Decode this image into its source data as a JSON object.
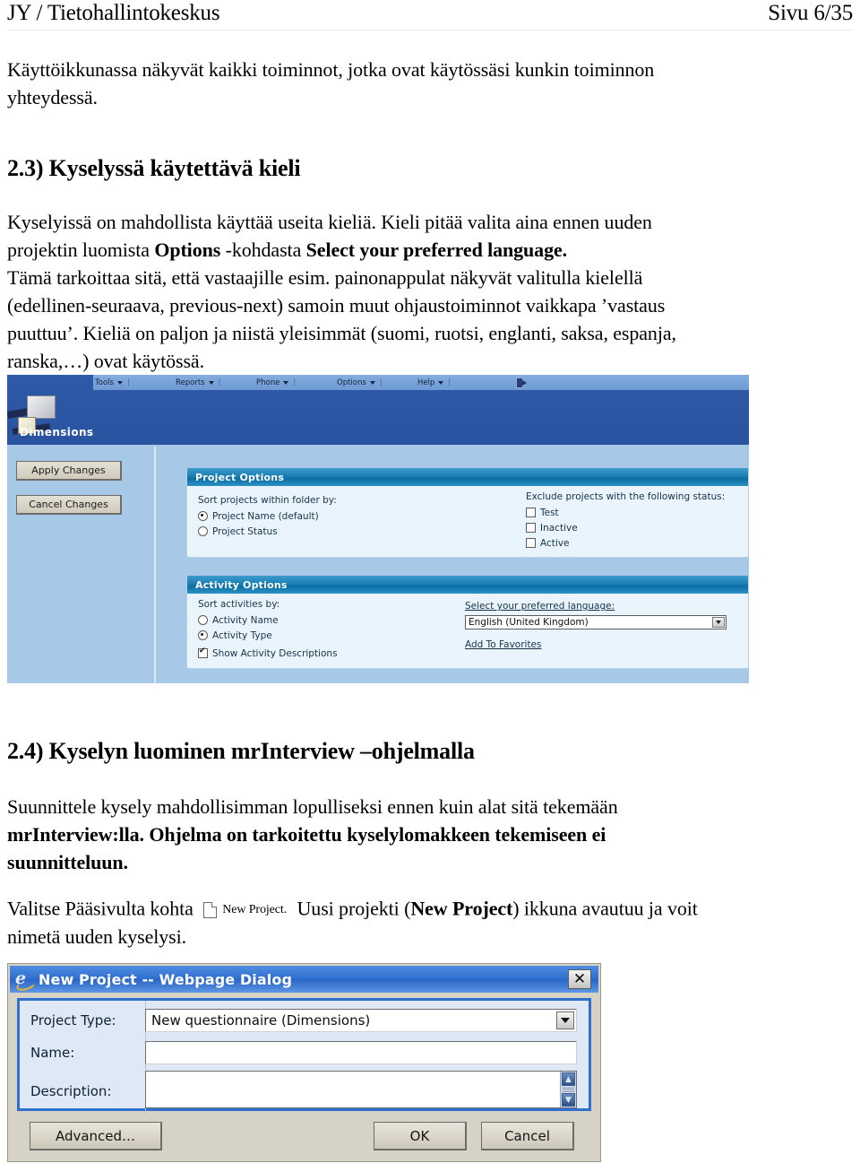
{
  "header": {
    "left": "JY / Tietohallintokeskus",
    "right": "Sivu 6/35"
  },
  "intro": {
    "line1": "Käyttöikkunassa näkyvät kaikki toiminnot, jotka ovat käytössäsi kunkin toiminnon",
    "line2": "yhteydessä."
  },
  "section23": {
    "heading": "2.3) Kyselyssä käytettävä kieli",
    "p1_a": "Kyselyissä on mahdollista käyttää useita kieliä. Kieli pitää valita aina ennen uuden",
    "p1_b": "projektin luomista ",
    "p1_bold1": "Options",
    "p1_c": " -kohdasta ",
    "p1_bold2": "Select your preferred language.",
    "p2": "Tämä tarkoittaa sitä, että vastaajille esim. painonappulat näkyvät valitulla kielellä",
    "p3": "(edellinen-seuraava, previous-next) samoin muut ohjaustoiminnot vaikkapa ’vastaus",
    "p4": "puuttuu’. Kieliä on paljon ja niistä yleisimmät (suomi, ruotsi, englanti, saksa, espanja,",
    "p5": "ranska,…) ovat käytössä."
  },
  "dimensions_app": {
    "wordmark": "Dimensions",
    "menu": [
      {
        "label": "Tools"
      },
      {
        "label": "Reports"
      },
      {
        "label": "Phone"
      },
      {
        "label": "Options"
      },
      {
        "label": "Help"
      }
    ],
    "logout_icon": "logout-icon",
    "buttons": {
      "apply": "Apply Changes",
      "cancel": "Cancel Changes"
    },
    "project_options": {
      "title": "Project Options",
      "sort_label": "Sort projects within folder by:",
      "sort_options": [
        {
          "label": "Project Name (default)",
          "selected": true
        },
        {
          "label": "Project Status",
          "selected": false
        }
      ],
      "exclude_label": "Exclude projects with the following status:",
      "exclude_options": [
        {
          "label": "Test",
          "checked": false
        },
        {
          "label": "Inactive",
          "checked": false
        },
        {
          "label": "Active",
          "checked": false
        }
      ]
    },
    "activity_options": {
      "title": "Activity Options",
      "sort_label": "Sort activities by:",
      "sort_options": [
        {
          "label": "Activity Name",
          "selected": false
        },
        {
          "label": "Activity Type",
          "selected": true
        }
      ],
      "show_descriptions": {
        "label": "Show Activity Descriptions",
        "checked": true
      },
      "language_label": "Select your preferred language:",
      "language_value": "English (United Kingdom)",
      "add_to_favorites": "Add To Favorites"
    },
    "colors": {
      "banner": "#2b56a4",
      "menubar": "#7aa4d9",
      "pane": "#a8c8e8",
      "panel_title": "#1b7fb4",
      "panel_body": "#eaf4fd"
    }
  },
  "section24": {
    "heading": "2.4) Kyselyn luominen mrInterview –ohjelmalla",
    "p1": "Suunnittele kysely mahdollisimman lopulliseksi ennen kuin alat sitä tekemään",
    "p1_bold": "mrInterview:lla. Ohjelma on tarkoitettu kyselylomakkeen tekemiseen ei",
    "p1_bold2": "suunnitteluun.",
    "p2_a": "Valitse Pääsivulta kohta",
    "p2_icon_caption": "New Project.",
    "p2_b": "Uusi projekti (",
    "p2_bold": "New Project",
    "p2_c": ") ikkuna avautuu ja voit",
    "p2_d": "nimetä uuden kyselysi."
  },
  "new_project_dialog": {
    "title": "New Project -- Webpage Dialog",
    "close_label": "✕",
    "rows": [
      {
        "label": "Project Type:",
        "value": "New questionnaire (Dimensions)"
      },
      {
        "label": "Name:",
        "value": ""
      },
      {
        "label": "Description:",
        "value": ""
      }
    ],
    "buttons": {
      "advanced": "Advanced…",
      "ok": "OK",
      "cancel": "Cancel"
    },
    "colors": {
      "titlebar": "#2f6fd0",
      "frame": "#d6d2c6",
      "inner": "#dfe8f5"
    }
  }
}
